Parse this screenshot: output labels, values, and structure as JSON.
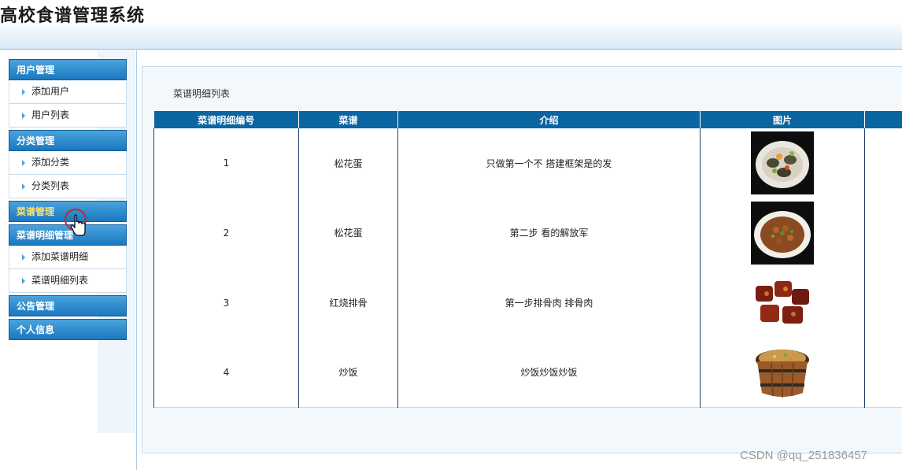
{
  "app": {
    "title": "高校食谱管理系统"
  },
  "sidebar": {
    "groups": [
      {
        "label": "用户管理",
        "items": [
          "添加用户",
          "用户列表"
        ]
      },
      {
        "label": "分类管理",
        "items": [
          "添加分类",
          "分类列表"
        ]
      },
      {
        "label": "菜谱管理",
        "items": []
      },
      {
        "label": "菜谱明细管理",
        "items": [
          "添加菜谱明细",
          "菜谱明细列表"
        ]
      },
      {
        "label": "公告管理",
        "items": []
      },
      {
        "label": "个人信息",
        "items": []
      }
    ]
  },
  "main": {
    "list_title": "菜谱明细列表",
    "columns": [
      "菜谱明细编号",
      "菜谱",
      "介绍",
      "图片"
    ],
    "rows": [
      {
        "id": "1",
        "recipe": "松花蛋",
        "intro": "只做第一个不 搭建框架是的发",
        "image": "dish-preserved-egg"
      },
      {
        "id": "2",
        "recipe": "松花蛋",
        "intro": "第二步 看的解放军",
        "image": "dish-beans-bowl"
      },
      {
        "id": "3",
        "recipe": "红烧排骨",
        "intro": "第一步排骨肉 排骨肉",
        "image": "dish-braised-ribs"
      },
      {
        "id": "4",
        "recipe": "炒饭",
        "intro": "炒饭炒饭炒饭",
        "image": "dish-fried-rice-bucket"
      }
    ]
  },
  "watermark": "CSDN @qq_251836457",
  "colors": {
    "menu_head": "#1b78bf",
    "table_header": "#0b65a0",
    "hover_text": "#ffe270"
  }
}
